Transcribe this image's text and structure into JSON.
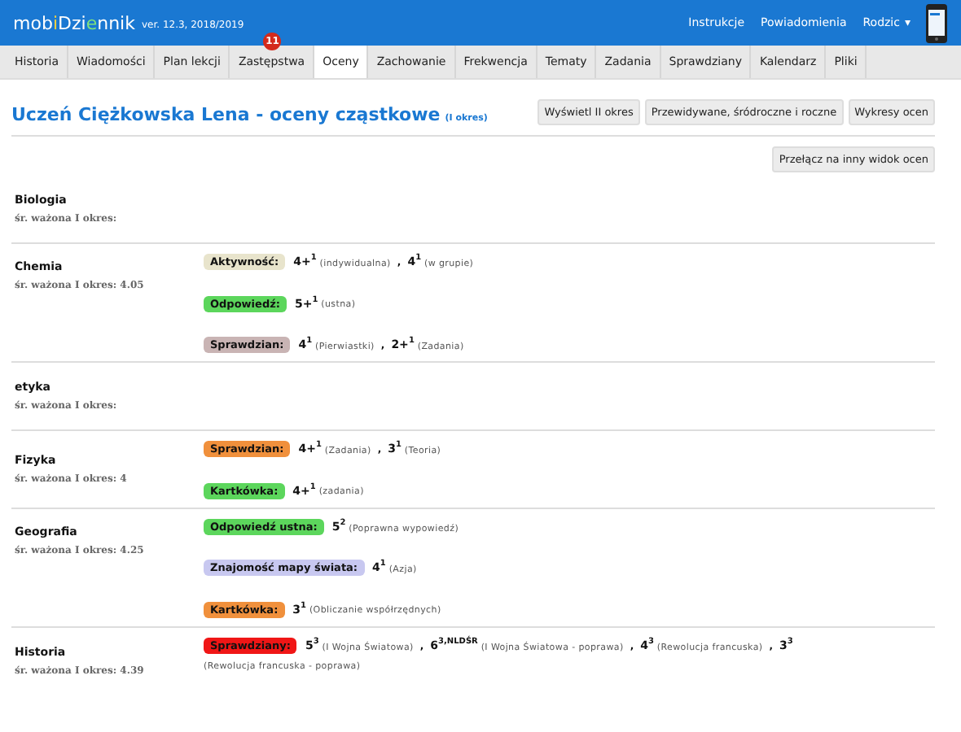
{
  "header": {
    "logo": [
      {
        "text": "mob",
        "color": "#ffffff"
      },
      {
        "text": "i",
        "color": "#ffd23c"
      },
      {
        "text": "Dzi",
        "color": "#ffffff"
      },
      {
        "text": "e",
        "color": "#7ee07e"
      },
      {
        "text": "nnik",
        "color": "#ffffff"
      }
    ],
    "version": "ver. 12.3, 2018/2019",
    "links": [
      "Instrukcje",
      "Powiadomienia"
    ],
    "user_menu": "Rodzic",
    "user_menu_caret": "▾"
  },
  "tabs": [
    {
      "label": "Historia",
      "selected": false
    },
    {
      "label": "Wiadomości",
      "selected": false
    },
    {
      "label": "Plan lekcji",
      "selected": false
    },
    {
      "label": "Zastępstwa",
      "selected": false,
      "badge": "11"
    },
    {
      "label": "Oceny",
      "selected": true
    },
    {
      "label": "Zachowanie",
      "selected": false
    },
    {
      "label": "Frekwencja",
      "selected": false
    },
    {
      "label": "Tematy",
      "selected": false
    },
    {
      "label": "Zadania",
      "selected": false
    },
    {
      "label": "Sprawdziany",
      "selected": false
    },
    {
      "label": "Kalendarz",
      "selected": false
    },
    {
      "label": "Pliki",
      "selected": false
    }
  ],
  "page": {
    "title": "Uczeń Ciężkowska Lena - oceny cząstkowe",
    "period": "(I okres)",
    "buttons": [
      "Wyświetl II okres",
      "Przewidywane, śródroczne i roczne",
      "Wykresy ocen"
    ],
    "switch_button": "Przełącz na inny widok ocen"
  },
  "subjects": [
    {
      "name": "Biologia",
      "average": "śr. ważona I okres:"
    },
    {
      "name": "Chemia",
      "average": "śr. ważona I okres: 4.05",
      "categories": [
        {
          "label": "Aktywność:",
          "color": "#e8e4cc",
          "grades": [
            {
              "value": "4+",
              "weight": "1",
              "note": "(indywidualna)"
            },
            {
              "separator": ",",
              "value": "4",
              "weight": "1",
              "note": "(w grupie)"
            }
          ]
        },
        {
          "label": "Odpowiedź:",
          "color": "#5cd65c",
          "grades": [
            {
              "value": "5+",
              "weight": "1",
              "note": "(ustna)"
            }
          ]
        },
        {
          "label": "Sprawdzian:",
          "color": "#c9b4b4",
          "grades": [
            {
              "value": "4",
              "weight": "1",
              "note": "(Pierwiastki)"
            },
            {
              "separator": ",",
              "value": "2+",
              "weight": "1",
              "note": "(Zadania)"
            }
          ]
        }
      ]
    },
    {
      "name": "etyka",
      "average": "śr. ważona I okres:"
    },
    {
      "name": "Fizyka",
      "average": "śr. ważona I okres: 4",
      "categories": [
        {
          "label": "Sprawdzian:",
          "color": "#f0903c",
          "grades": [
            {
              "value": "4+",
              "weight": "1",
              "note": "(Zadania)"
            },
            {
              "separator": ",",
              "value": "3",
              "weight": "1",
              "note": "(Teoria)"
            }
          ]
        },
        {
          "label": "Kartkówka:",
          "color": "#5cd65c",
          "grades": [
            {
              "value": "4+",
              "weight": "1",
              "note": "(zadania)"
            }
          ]
        }
      ]
    },
    {
      "name": "Geografia",
      "average": "śr. ważona I okres: 4.25",
      "categories": [
        {
          "label": "Odpowiedź ustna:",
          "color": "#5cd65c",
          "grades": [
            {
              "value": "5",
              "weight": "2",
              "note": "(Poprawna wypowiedź)"
            }
          ]
        },
        {
          "label": "Znajomość mapy świata:",
          "color": "#c8c8f0",
          "grades": [
            {
              "value": "4",
              "weight": "1",
              "note": "(Azja)"
            }
          ]
        },
        {
          "label": "Kartkówka:",
          "color": "#f0903c",
          "grades": [
            {
              "value": "3",
              "weight": "1",
              "note": "(Obliczanie współrzędnych)"
            }
          ]
        }
      ]
    },
    {
      "name": "Historia",
      "average": "śr. ważona I okres: 4.39",
      "categories": [
        {
          "label": "Sprawdziany:",
          "color": "#f01616",
          "grades": [
            {
              "value": "5",
              "weight": "3",
              "note": "(I Wojna Światowa)"
            },
            {
              "separator": ",",
              "value": "6",
              "weight": "3,NLDŚR",
              "note": "(I Wojna Światowa - poprawa)"
            },
            {
              "separator": ",",
              "value": "4",
              "weight": "3",
              "note": "(Rewolucja francuska)"
            },
            {
              "separator": ",",
              "value": "3",
              "weight": "3",
              "note": "(Rewolucja francuska - poprawa)"
            }
          ]
        }
      ]
    }
  ]
}
